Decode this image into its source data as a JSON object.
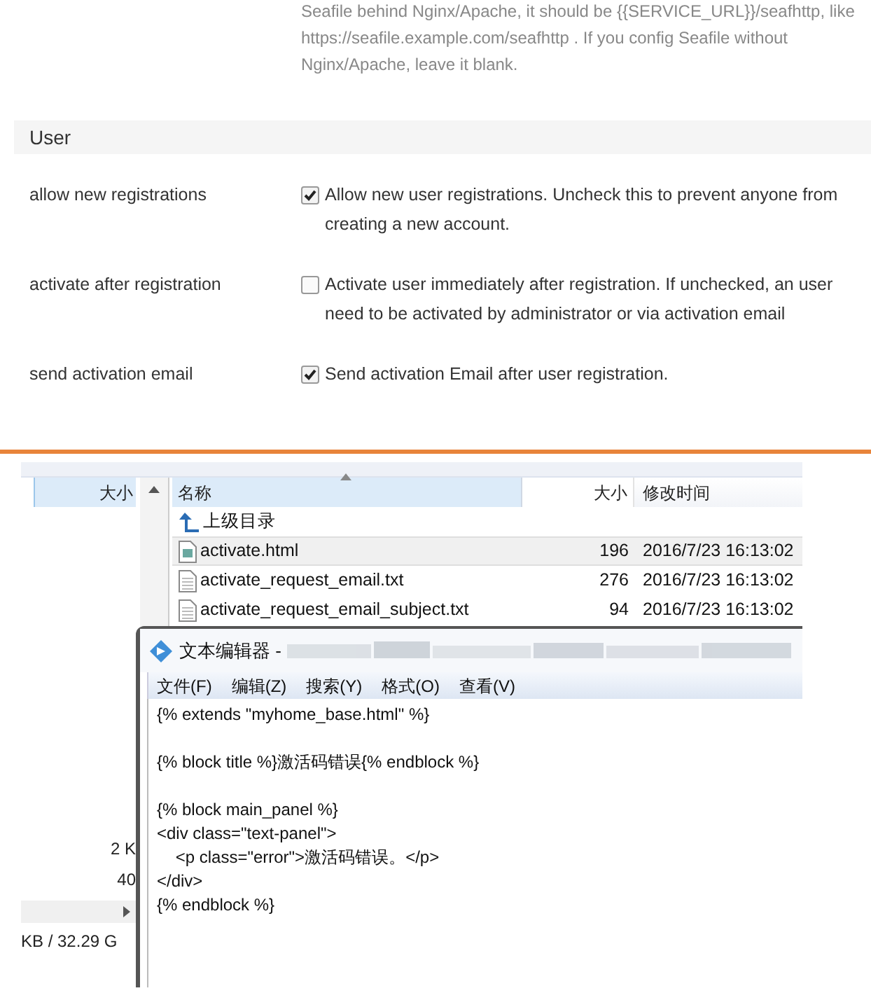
{
  "settings_note": "Seafile behind Nginx/Apache, it should be {{SERVICE_URL}}/seafhttp, like https://seafile.example.com/seafhttp . If you config Seafile without Nginx/Apache, leave it blank.",
  "section": {
    "title": "User"
  },
  "settings": [
    {
      "label": "allow new registrations",
      "checked": true,
      "description": "Allow new user registrations. Uncheck this to prevent anyone from creating a new account."
    },
    {
      "label": "activate after registration",
      "checked": false,
      "description": "Activate user immediately after registration. If unchecked, an user need to be activated by administrator or via activation email"
    },
    {
      "label": "send activation email",
      "checked": true,
      "description": "Send activation Email after user registration."
    }
  ],
  "explorer": {
    "left_pane": {
      "column": "大小",
      "values": [
        "2 K",
        "40"
      ],
      "status": "KB / 32.29 G"
    },
    "columns": [
      "名称",
      "大小",
      "修改时间"
    ],
    "rows": [
      {
        "kind": "parent",
        "name": "上级目录",
        "selected": false
      },
      {
        "kind": "html",
        "name": "activate.html",
        "size": "196",
        "modified": "2016/7/23 16:13:02",
        "selected": true
      },
      {
        "kind": "txt",
        "name": "activate_request_email.txt",
        "size": "276",
        "modified": "2016/7/23 16:13:02",
        "selected": false
      },
      {
        "kind": "txt",
        "name": "activate_request_email_subject.txt",
        "size": "94",
        "modified": "2016/7/23 16:13:02",
        "selected": false
      }
    ]
  },
  "editor": {
    "title": "文本编辑器 -",
    "menu": [
      "文件(F)",
      "编辑(Z)",
      "搜索(Y)",
      "格式(O)",
      "查看(V)"
    ],
    "paragraphs": [
      [
        "{% extends \"myhome_base.html\" %}"
      ],
      [
        "{% block title %}激活码错误{% endblock %}"
      ],
      [
        "{% block main_panel %}",
        "<div class=\"text-panel\">",
        "    <p class=\"error\">激活码错误。</p>",
        "</div>",
        "{% endblock %}"
      ]
    ]
  }
}
